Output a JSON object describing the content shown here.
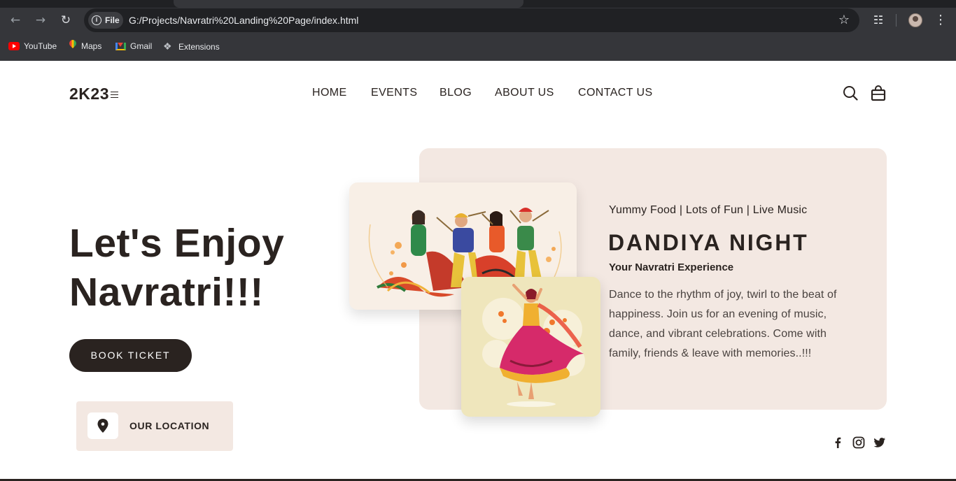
{
  "browser": {
    "file_chip": "File",
    "url": "G:/Projects/Navratri%20Landing%20Page/index.html",
    "bookmarks": [
      {
        "label": "YouTube",
        "icon": "youtube-icon"
      },
      {
        "label": "Maps",
        "icon": "maps-icon"
      },
      {
        "label": "Gmail",
        "icon": "gmail-icon"
      },
      {
        "label": "Extensions",
        "icon": "puzzle-icon"
      }
    ]
  },
  "header": {
    "logo": "2K23",
    "nav": [
      "HOME",
      "EVENTS",
      "BLOG",
      "ABOUT US",
      "CONTACT US"
    ]
  },
  "hero": {
    "title_line1": "Let's Enjoy",
    "title_line2": "Navratri!!!",
    "cta": "BOOK TICKET",
    "location_label": "OUR LOCATION"
  },
  "event": {
    "tagline": "Yummy Food | Lots of Fun | Live Music",
    "title": "DANDIYA NIGHT",
    "subtitle": "Your Navratri Experience",
    "description": "Dance to the rhythm of joy, twirl to the beat of happiness. Join us for an evening of music, dance, and vibrant celebrations. Come with family, friends & leave with memories..!!!"
  },
  "social": [
    "facebook-icon",
    "instagram-icon",
    "twitter-icon"
  ],
  "colors": {
    "dark": "#2a2320",
    "panel": "#f3e8e2",
    "chrome": "#35363a"
  }
}
